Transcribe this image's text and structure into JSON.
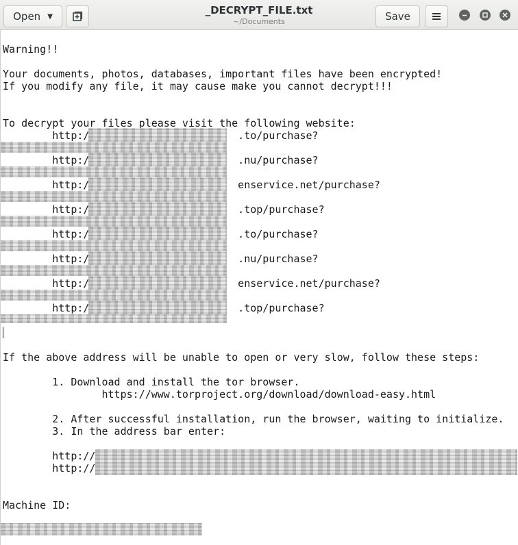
{
  "header": {
    "open_label": "Open",
    "save_label": "Save",
    "title": "_DECRYPT_FILE.txt",
    "subtitle": "~/Documents"
  },
  "icons": {
    "dropdown": "chevron-down-icon",
    "new_tab": "new-document-icon",
    "menu": "hamburger-menu-icon",
    "minimize": "minimize-icon",
    "maximize": "maximize-icon",
    "close": "close-icon"
  },
  "document": {
    "warning": "Warning!!",
    "line1": "Your documents, photos, databases, important files have been encrypted!",
    "line2": "If you modify any file, it may cause make you cannot decrypt!!!",
    "visit": "To decrypt your files please visit the following website:",
    "urls": [
      "        http:/                        .to/purchase?",
      "        http:/                        .nu/purchase?",
      "        http:/                        enservice.net/purchase?",
      "        http:/                        .top/purchase?",
      "        http:/                        .to/purchase?",
      "        http:/                        .nu/purchase?",
      "        http:/                        enservice.net/purchase?",
      "        http:/                        .top/purchase?"
    ],
    "unable": "If the above address will be unable to open or very slow, follow these steps:",
    "step1": "        1. Download and install the tor browser.",
    "step1_url": "                https://www.torproject.org/download/download-easy.html",
    "step2": "        2. After successful installation, run the browser, waiting to initialize.",
    "step3": "        3. In the address bar enter:",
    "tor_url1": "        http://",
    "tor_url2": "        http://",
    "machine_id": "Machine ID:"
  }
}
